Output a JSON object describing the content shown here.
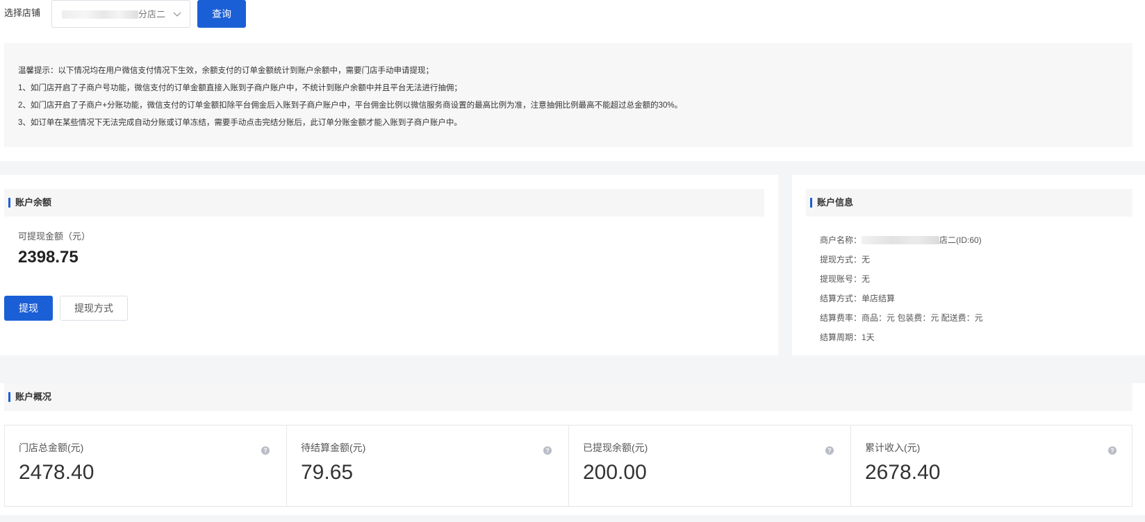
{
  "filter": {
    "label": "选择店铺",
    "store_value": "分店二",
    "query_label": "查询"
  },
  "tips": {
    "lines": [
      "温馨提示：以下情况均在用户微信支付情况下生效，余额支付的订单金额统计到账户余额中，需要门店手动申请提现；",
      "1、如门店开启了子商户号功能，微信支付的订单金额直接入账到子商户账户中，不统计到账户余额中并且平台无法进行抽佣；",
      "2、如门店开启了子商户+分账功能，微信支付的订单金额扣除平台佣金后入账到子商户账户中，平台佣金比例以微信服务商设置的最高比例为准，注意抽佣比例最高不能超过总金额的30%。",
      "3、如订单在某些情况下无法完成自动分账或订单冻结，需要手动点击完结分账后，此订单分账金额才能入账到子商户账户中。"
    ]
  },
  "balance": {
    "title": "账户余额",
    "label": "可提现金额（元）",
    "value": "2398.75",
    "withdraw_label": "提现",
    "method_label": "提现方式"
  },
  "account": {
    "title": "账户信息",
    "merchant_prefix": "商户名称：",
    "merchant_suffix": "店二(ID:60)",
    "method": "提现方式：无",
    "number": "提现账号：无",
    "settle_type": "结算方式：单店结算",
    "rate": "结算费率：商品：元 包装费：元 配送费：元",
    "period": "结算周期：1天"
  },
  "overview": {
    "title": "账户概况",
    "cards": [
      {
        "label": "门店总金额(元)",
        "value": "2478.40"
      },
      {
        "label": "待结算金额(元)",
        "value": "79.65"
      },
      {
        "label": "已提现余额(元)",
        "value": "200.00"
      },
      {
        "label": "累计收入(元)",
        "value": "2678.40"
      }
    ]
  },
  "icons": {
    "select_chevron": "chevron-down-icon",
    "help": "question-icon"
  },
  "colors": {
    "primary": "#1b5fd6",
    "section_bg": "#f4f5f7"
  }
}
